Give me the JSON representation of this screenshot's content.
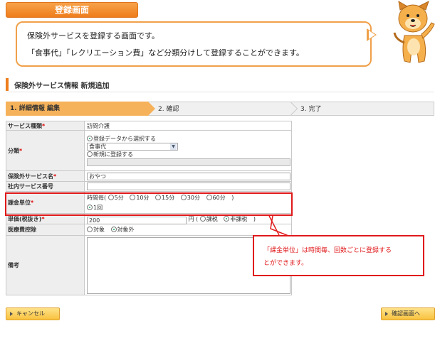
{
  "header": {
    "title": "登録画面",
    "description_line1": "保険外サービスを登録する画面です。",
    "description_line2": "「食事代」「レクリエーション費」など分類分けして登録することができます。"
  },
  "section": {
    "title": "保険外サービス情報 新規追加"
  },
  "steps": [
    {
      "label": "1. 詳細情報 編集"
    },
    {
      "label": "2. 確認"
    },
    {
      "label": "3. 完了"
    }
  ],
  "form": {
    "service_type": {
      "label": "サービス種類",
      "required_mark": "*",
      "value": "訪問介護"
    },
    "category": {
      "label": "分類",
      "required_mark": "*",
      "option_select_label": "登録データから選択する",
      "selected_value": "食事代",
      "option_new_label": "新規に登録する"
    },
    "service_name": {
      "label": "保険外サービス名",
      "required_mark": "*",
      "value": "おやつ"
    },
    "internal_code": {
      "label": "社内サービス番号",
      "value": ""
    },
    "billing_unit": {
      "label": "課金単位",
      "required_mark": "*",
      "prefix": "時間毎(",
      "options": [
        "5分",
        "10分",
        "15分",
        "30分",
        "60分"
      ],
      "suffix": ")",
      "per_time_label": "1回"
    },
    "unit_price": {
      "label": "単価(税抜き)",
      "required_mark": "*",
      "value": "200",
      "unit": "円",
      "tax_prefix": "(",
      "taxable_label": "課税",
      "nontaxable_label": "非課税",
      "tax_suffix": ")"
    },
    "medical_deduction": {
      "label": "医療費控除",
      "option_target": "対象",
      "option_excluded": "対象外"
    },
    "notes": {
      "label": "備考",
      "value": ""
    }
  },
  "callout": {
    "line1": "「課金単位」は時間毎、回数ごとに登録する",
    "line2": "とができます。"
  },
  "buttons": {
    "cancel": "キャンセル",
    "confirm": "確認画面へ"
  },
  "colors": {
    "accent_orange": "#ee7d1c",
    "highlight_red": "#e0191b",
    "button_yellow": "#f8c23e"
  }
}
